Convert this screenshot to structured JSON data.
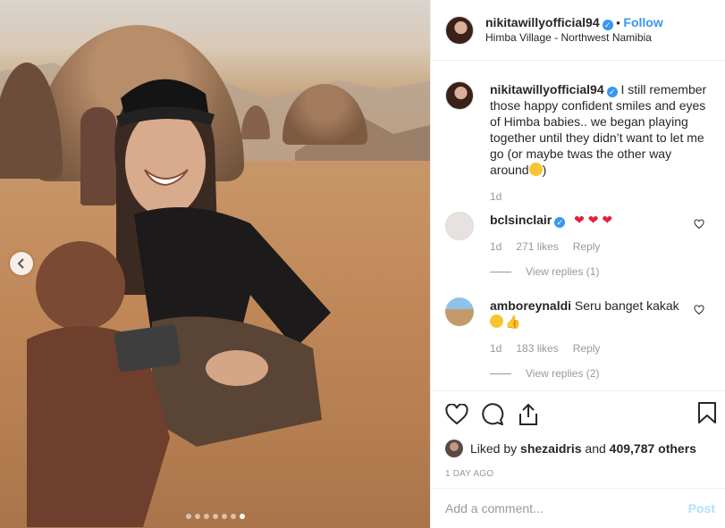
{
  "post": {
    "username": "nikitawillyofficial94",
    "follow_label": "Follow",
    "location": "Himba Village - Northwest Namibia",
    "caption": "I still remember those happy confident smiles and eyes of Himba babies.. we began playing together until they didn’t want to let me go (or maybe twas the other way around",
    "caption_time": "1d",
    "carousel": {
      "count": 7,
      "active_index": 6
    }
  },
  "comments": [
    {
      "username": "bclsinclair",
      "text": "",
      "emoji": [
        "heart",
        "heart",
        "heart"
      ],
      "time": "1d",
      "likes": "271 likes",
      "reply": "Reply",
      "view_replies": "View replies (1)"
    },
    {
      "username": "amboreynaldi",
      "text": "Seru banget kakak",
      "emoji": [
        "grin-face",
        "thumbs-up"
      ],
      "time": "1d",
      "likes": "183 likes",
      "reply": "Reply",
      "view_replies": "View replies (2)"
    }
  ],
  "likes": {
    "prefix": "Liked by",
    "user": "shezaidris",
    "and": "and",
    "count": "409,787 others"
  },
  "timestamp": "1 DAY AGO",
  "add_comment": {
    "placeholder": "Add a comment...",
    "post_label": "Post"
  },
  "colors": {
    "link_blue": "#3897f0",
    "post_disabled": "#b2dffc",
    "heart_red": "#e0223f",
    "muted": "#999999"
  },
  "icons": [
    "heart-icon",
    "comment-icon",
    "share-icon",
    "bookmark-icon",
    "verified-icon",
    "chevron-left-icon"
  ]
}
